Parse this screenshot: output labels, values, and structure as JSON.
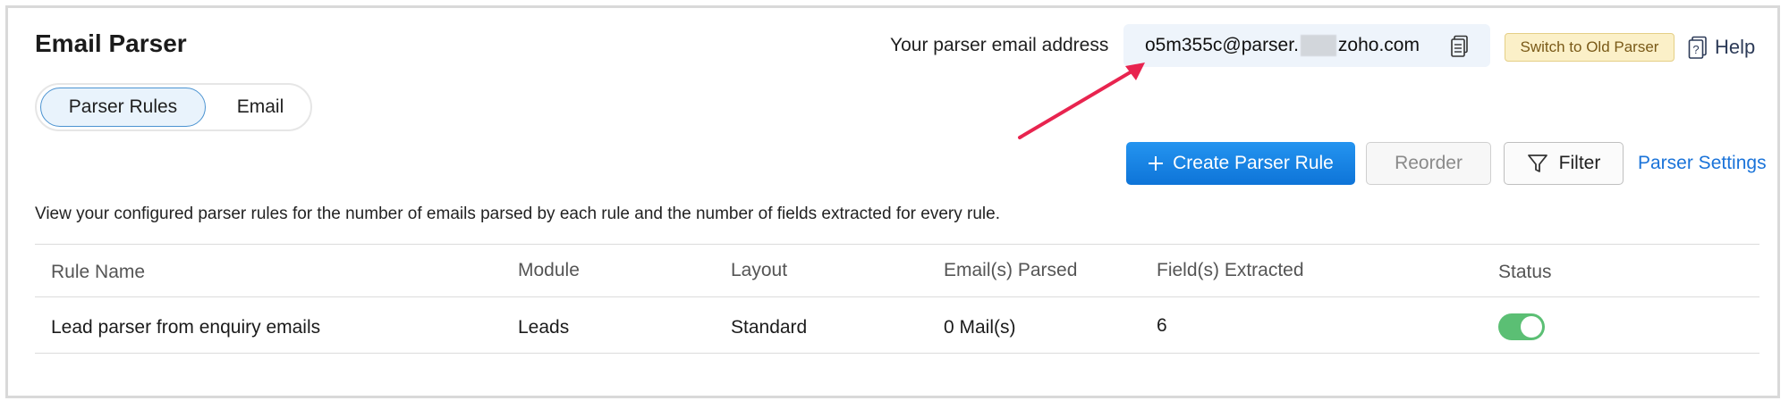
{
  "header": {
    "title": "Email Parser",
    "address_label": "Your parser email address",
    "address_prefix": "o5m355c@parser.",
    "address_suffix": "zoho.com",
    "old_parser_label": "Switch to Old Parser",
    "help_label": "Help"
  },
  "tabs": [
    {
      "label": "Parser Rules",
      "active": true
    },
    {
      "label": "Email",
      "active": false
    }
  ],
  "toolbar": {
    "create_label": "Create Parser Rule",
    "reorder_label": "Reorder",
    "filter_label": "Filter",
    "settings_label": "Parser Settings"
  },
  "description": "View your configured parser rules for the number of emails parsed by each rule and the number of fields extracted for every rule.",
  "table": {
    "columns": [
      "Rule Name",
      "Module",
      "Layout",
      "Email(s) Parsed",
      "Field(s) Extracted",
      "Status"
    ],
    "rows": [
      {
        "rule_name": "Lead parser from enquiry emails",
        "module": "Leads",
        "layout": "Standard",
        "emails_parsed": "0 Mail(s)",
        "fields_extracted": "6",
        "status_on": true
      }
    ]
  },
  "colors": {
    "accent": "#1e88e5",
    "toggle_on": "#5bbf74",
    "annotation_arrow": "#e8244f"
  },
  "icons": [
    "copy-icon",
    "help-icon",
    "plus-icon",
    "filter-icon"
  ]
}
